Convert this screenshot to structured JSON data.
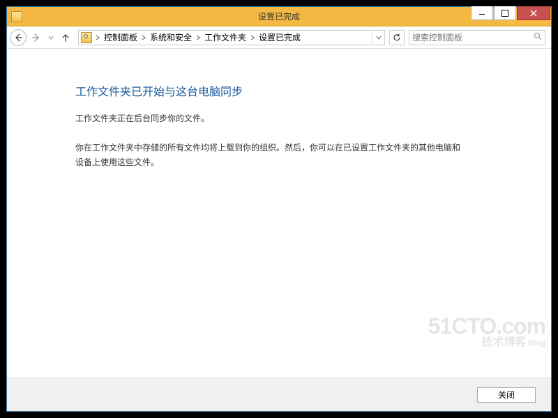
{
  "window": {
    "title": "设置已完成"
  },
  "breadcrumb": {
    "items": [
      "控制面板",
      "系统和安全",
      "工作文件夹",
      "设置已完成"
    ]
  },
  "search": {
    "placeholder": "搜索控制面板"
  },
  "content": {
    "heading": "工作文件夹已开始与这台电脑同步",
    "line1": "工作文件夹正在后台同步你的文件。",
    "line2": "你在工作文件夹中存储的所有文件均将上载到你的组织。然后，你可以在已设置工作文件夹的其他电脑和设备上使用这些文件。"
  },
  "footer": {
    "close_label": "关闭"
  },
  "watermark": {
    "line1": "51CTO.com",
    "line2": "技术博客",
    "blog": "Blog"
  }
}
